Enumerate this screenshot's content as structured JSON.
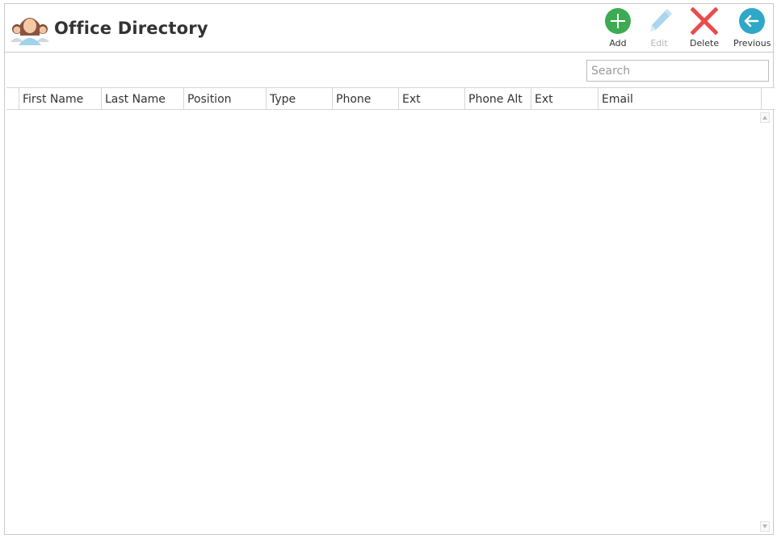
{
  "app": {
    "title": "Office Directory"
  },
  "toolbar": {
    "add_label": "Add",
    "edit_label": "Edit",
    "delete_label": "Delete",
    "previous_label": "Previous"
  },
  "search": {
    "placeholder": "Search",
    "value": ""
  },
  "grid": {
    "columns": [
      "First Name",
      "Last Name",
      "Position",
      "Type",
      "Phone",
      "Ext",
      "Phone Alt",
      "Ext",
      "Email"
    ],
    "rows": []
  },
  "colors": {
    "add": "#3cab52",
    "edit_disabled": "#a9d6ee",
    "delete": "#e84c4c",
    "previous": "#2ea7c8"
  },
  "icons": {
    "logo": "people-group-icon",
    "add": "plus-circle-icon",
    "edit": "pencil-icon",
    "delete": "x-icon",
    "previous": "arrow-left-circle-icon",
    "scroll_up": "scroll-up-arrow-icon",
    "scroll_down": "scroll-down-arrow-icon"
  }
}
